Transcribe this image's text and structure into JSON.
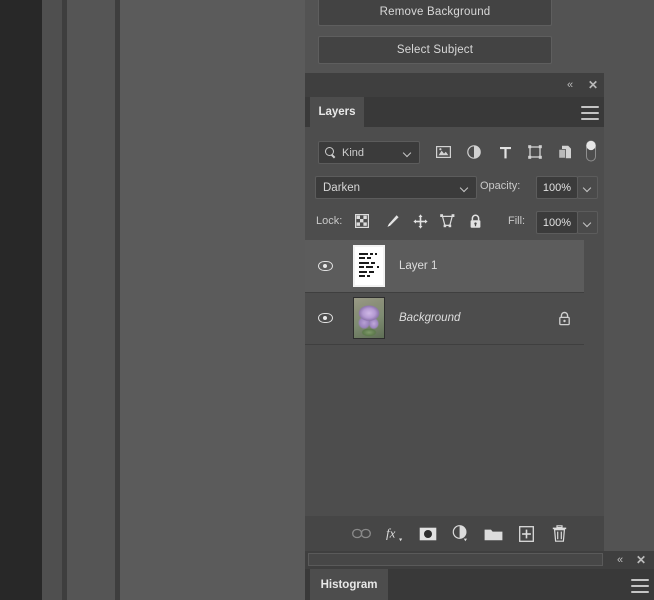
{
  "top_actions": {
    "remove_background": "Remove Background",
    "select_subject": "Select Subject"
  },
  "layers_panel": {
    "titlebar": {
      "collapse_icon": "collapse-to-icons",
      "collapse_glyph": "«",
      "close_icon": "close-panel",
      "close_glyph": "✕"
    },
    "tab": "Layers",
    "menu_icon": "panel-menu-icon",
    "filter": {
      "search_icon": "search-icon",
      "kind_label": "Kind",
      "caret": "chevron-down-icon",
      "icons": [
        {
          "name": "filter-pixel-layers-icon",
          "title": "Pixel"
        },
        {
          "name": "filter-adjustment-layers-icon",
          "title": "Adjustment"
        },
        {
          "name": "filter-type-layers-icon",
          "title": "Type"
        },
        {
          "name": "filter-shape-layers-icon",
          "title": "Shape"
        },
        {
          "name": "filter-smart-object-layers-icon",
          "title": "Smart Object"
        }
      ],
      "toggle_name": "filter-enable-toggle"
    },
    "blend": {
      "mode": "Darken",
      "opacity_label": "Opacity:",
      "opacity_value": "100%"
    },
    "lock": {
      "label": "Lock:",
      "icons": [
        {
          "name": "lock-transparent-pixels-icon"
        },
        {
          "name": "lock-image-pixels-icon"
        },
        {
          "name": "lock-position-icon"
        },
        {
          "name": "lock-artboard-nesting-icon"
        },
        {
          "name": "lock-all-icon"
        }
      ],
      "fill_label": "Fill:",
      "fill_value": "100%"
    },
    "layers": [
      {
        "name": "Layer 1",
        "visible": true,
        "selected": true,
        "locked": false,
        "italic": false,
        "thumbnail": "text-document-thumbnail"
      },
      {
        "name": "Background",
        "visible": true,
        "selected": false,
        "locked": true,
        "italic": true,
        "thumbnail": "iris-flower-photo-thumbnail"
      }
    ],
    "actions": [
      {
        "name": "link-layers-button",
        "label": "Link layers"
      },
      {
        "name": "layer-style-fx-button",
        "label": "Add a layer style"
      },
      {
        "name": "add-layer-mask-button",
        "label": "Add layer mask"
      },
      {
        "name": "new-adjustment-layer-button",
        "label": "Create new fill or adjustment layer"
      },
      {
        "name": "new-group-button",
        "label": "Create a new group"
      },
      {
        "name": "new-layer-button",
        "label": "Create a new layer"
      },
      {
        "name": "delete-layer-button",
        "label": "Delete layer"
      }
    ]
  },
  "histogram_panel": {
    "tab": "Histogram",
    "collapse_glyph": "«",
    "close_glyph": "✕",
    "menu_icon": "panel-menu-icon"
  },
  "colors": {
    "app_background": "#535353",
    "panel_background": "#4d4d4d",
    "panel_header": "#393939",
    "titlebar": "#3f3f3f",
    "selected_row": "#5c5c5c",
    "field_background": "#3b3b3b",
    "text": "#d6d6d6",
    "canvas_dark": "#282828"
  }
}
